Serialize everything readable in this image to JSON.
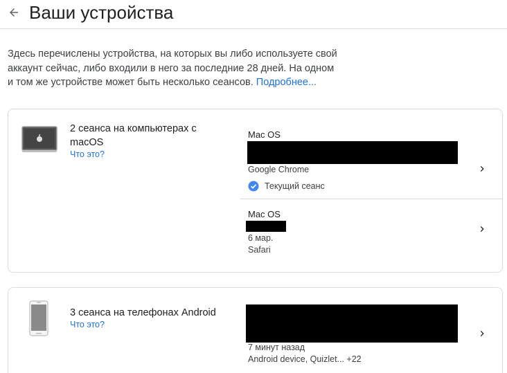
{
  "header": {
    "title": "Ваши устройства",
    "back_icon": "arrow-back-icon"
  },
  "intro": {
    "text": "Здесь перечислены устройства, на которых вы либо используете свой аккаунт сейчас, либо входили в него за последние 28 дней. На одном и том же устройстве может быть несколько сеансов.",
    "link": "Подробнее..."
  },
  "groups": [
    {
      "title": "2 сеанса на компьютерах с macOS",
      "what_link": "Что это?",
      "icon": "laptop-icon",
      "sessions": [
        {
          "os": "Mac OS",
          "browser": "Google Chrome",
          "current_label": "Текущий сеанс"
        },
        {
          "os": "Mac OS",
          "date": "6 мар.",
          "browser": "Safari"
        }
      ]
    },
    {
      "title": "3 сеанса на телефонах Android",
      "what_link": "Что это?",
      "icon": "phone-icon",
      "sessions": [
        {
          "time": "7 минут назад",
          "apps": "Android device, Quizlet... +22"
        }
      ]
    }
  ],
  "colors": {
    "link": "#1a73e8",
    "check": "#4285f4",
    "border": "#dadce0"
  }
}
